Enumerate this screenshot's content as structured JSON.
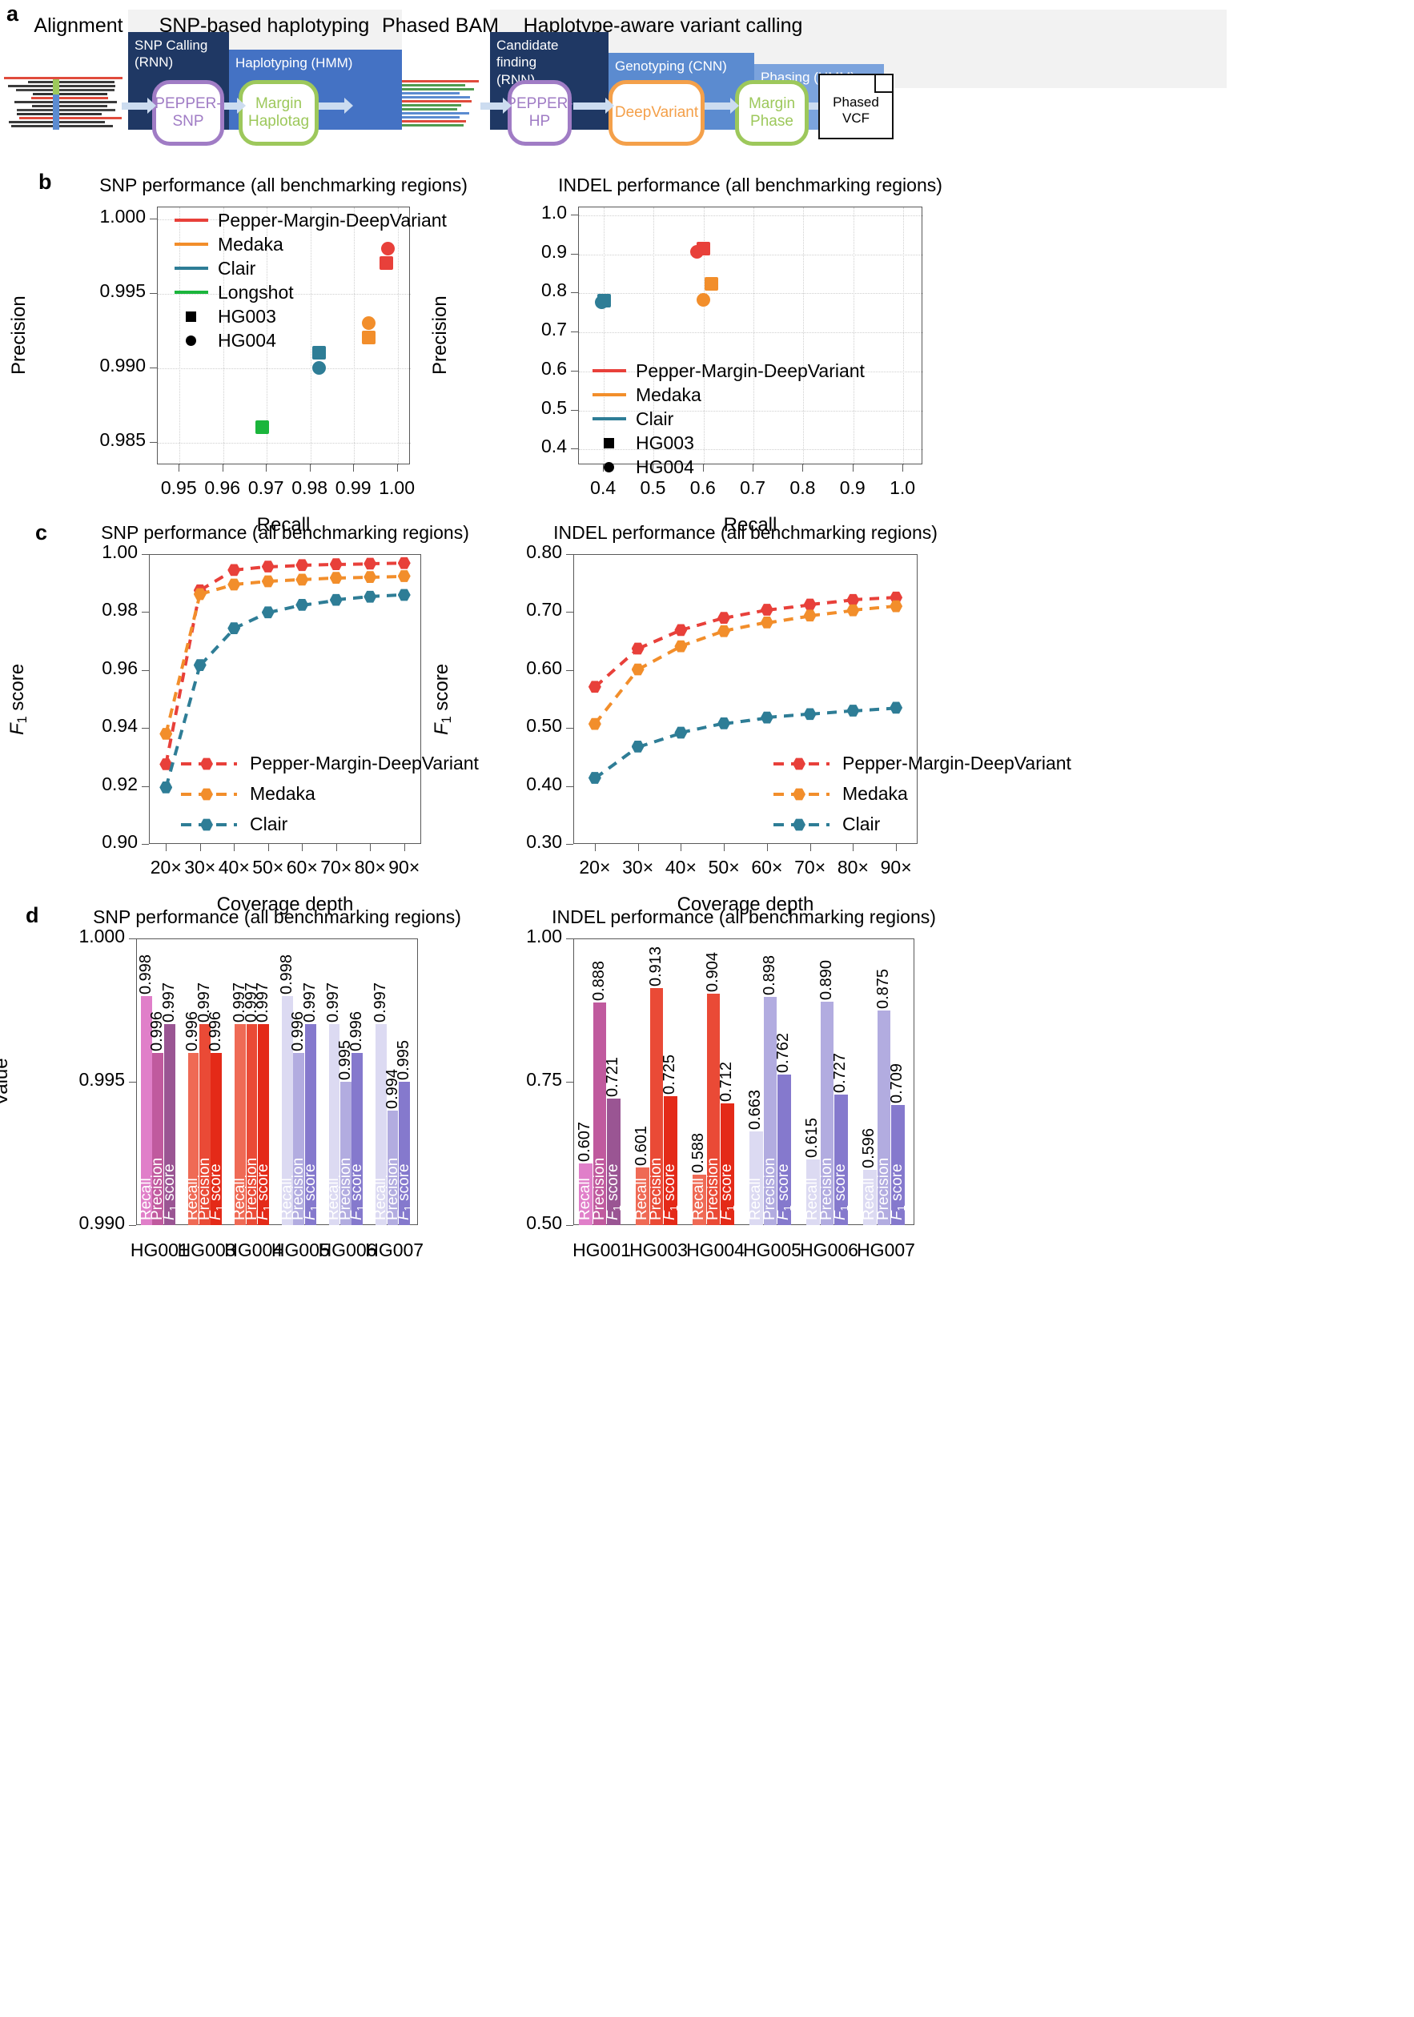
{
  "panels": {
    "a": {
      "letter": "a"
    },
    "b": {
      "letter": "b"
    },
    "c": {
      "letter": "c"
    },
    "d": {
      "letter": "d"
    }
  },
  "diagram": {
    "groups": [
      {
        "label": "Alignment"
      },
      {
        "label": "SNP-based haplotyping"
      },
      {
        "label": "Phased BAM"
      },
      {
        "label": "Haplotype-aware variant calling"
      }
    ],
    "stages": [
      {
        "label": "SNP Calling\n(RNN)",
        "color": "#1f3864"
      },
      {
        "label": "Haplotyping (HMM)",
        "color": "#4472c4"
      },
      {
        "label": "Candidate finding\n(RNN)",
        "color": "#1f3864"
      },
      {
        "label": "Genotyping (CNN)",
        "color": "#5b8bd0"
      },
      {
        "label": "Phasing (HMM)",
        "color": "#7ba3dd"
      }
    ],
    "tools": [
      {
        "label": "PEPPER-\nSNP",
        "color": "#a07cc5"
      },
      {
        "label": "Margin\nHaplotag",
        "color": "#9dc85b"
      },
      {
        "label": "PEPPER-\nHP",
        "color": "#a07cc5"
      },
      {
        "label": "DeepVariant",
        "color": "#f5a košice"
      },
      {
        "label": "Margin\nPhase",
        "color": "#9dc85b"
      }
    ],
    "output": {
      "label": "Phased\nVCF"
    }
  },
  "colors": {
    "pepper": "#e8403a",
    "medaka": "#f28e2b",
    "clair": "#2e7d96",
    "longshot": "#1bb53c",
    "deepvariant_orange": "#f4a04a",
    "purple": "#a07cc5",
    "green": "#9dc85b",
    "navy": "#1f3864",
    "blue": "#4472c4"
  },
  "chart_data": [
    {
      "id": "b-snp",
      "type": "scatter",
      "title": "SNP performance (all benchmarking regions)",
      "xlabel": "Recall",
      "ylabel": "Precision",
      "xlim": [
        0.945,
        1.003
      ],
      "ylim": [
        0.9835,
        1.0008
      ],
      "xticks": [
        "0.95",
        "0.96",
        "0.97",
        "0.98",
        "0.99",
        "1.00"
      ],
      "xtickvals": [
        0.95,
        0.96,
        0.97,
        0.98,
        0.99,
        1.0
      ],
      "yticks": [
        "0.985",
        "0.990",
        "0.995",
        "1.000"
      ],
      "ytickvals": [
        0.985,
        0.99,
        0.995,
        1.0
      ],
      "legend": [
        {
          "label": "Pepper-Margin-DeepVariant",
          "color": "#e8403a",
          "kind": "line"
        },
        {
          "label": "Medaka",
          "color": "#f28e2b",
          "kind": "line"
        },
        {
          "label": "Clair",
          "color": "#2e7d96",
          "kind": "line"
        },
        {
          "label": "Longshot",
          "color": "#1bb53c",
          "kind": "line"
        },
        {
          "label": "HG003",
          "color": "#000000",
          "kind": "square"
        },
        {
          "label": "HG004",
          "color": "#000000",
          "kind": "circle"
        }
      ],
      "points": [
        {
          "series": "Pepper-Margin-DeepVariant",
          "sample": "HG003",
          "marker": "square",
          "color": "#e8403a",
          "x": 0.9975,
          "y": 0.997
        },
        {
          "series": "Pepper-Margin-DeepVariant",
          "sample": "HG004",
          "marker": "circle",
          "color": "#e8403a",
          "x": 0.998,
          "y": 0.998
        },
        {
          "series": "Medaka",
          "sample": "HG003",
          "marker": "square",
          "color": "#f28e2b",
          "x": 0.9935,
          "y": 0.992
        },
        {
          "series": "Medaka",
          "sample": "HG004",
          "marker": "circle",
          "color": "#f28e2b",
          "x": 0.9935,
          "y": 0.993
        },
        {
          "series": "Clair",
          "sample": "HG003",
          "marker": "square",
          "color": "#2e7d96",
          "x": 0.9822,
          "y": 0.991
        },
        {
          "series": "Clair",
          "sample": "HG004",
          "marker": "circle",
          "color": "#2e7d96",
          "x": 0.9822,
          "y": 0.99
        },
        {
          "series": "Longshot",
          "sample": "HG003",
          "marker": "square",
          "color": "#1bb53c",
          "x": 0.9692,
          "y": 0.986
        },
        {
          "series": "Longshot",
          "sample": "HG004",
          "marker": "circle",
          "color": "#1bb53c",
          "x": 0.9692,
          "y": 0.986
        }
      ]
    },
    {
      "id": "b-indel",
      "type": "scatter",
      "title": "INDEL performance (all benchmarking regions)",
      "xlabel": "Recall",
      "ylabel": "Precision",
      "xlim": [
        0.35,
        1.04
      ],
      "ylim": [
        0.36,
        1.02
      ],
      "xticks": [
        "0.4",
        "0.5",
        "0.6",
        "0.7",
        "0.8",
        "0.9",
        "1.0"
      ],
      "xtickvals": [
        0.4,
        0.5,
        0.6,
        0.7,
        0.8,
        0.9,
        1.0
      ],
      "yticks": [
        "0.4",
        "0.5",
        "0.6",
        "0.7",
        "0.8",
        "0.9",
        "1.0"
      ],
      "ytickvals": [
        0.4,
        0.5,
        0.6,
        0.7,
        0.8,
        0.9,
        1.0
      ],
      "legend": [
        {
          "label": "Pepper-Margin-DeepVariant",
          "color": "#e8403a",
          "kind": "line"
        },
        {
          "label": "Medaka",
          "color": "#f28e2b",
          "kind": "line"
        },
        {
          "label": "Clair",
          "color": "#2e7d96",
          "kind": "line"
        },
        {
          "label": "HG003",
          "color": "#000000",
          "kind": "square"
        },
        {
          "label": "HG004",
          "color": "#000000",
          "kind": "circle"
        }
      ],
      "points": [
        {
          "series": "Pepper-Margin-DeepVariant",
          "sample": "HG003",
          "marker": "square",
          "color": "#e8403a",
          "x": 0.601,
          "y": 0.913
        },
        {
          "series": "Pepper-Margin-DeepVariant",
          "sample": "HG004",
          "marker": "circle",
          "color": "#e8403a",
          "x": 0.588,
          "y": 0.904
        },
        {
          "series": "Medaka",
          "sample": "HG003",
          "marker": "square",
          "color": "#f28e2b",
          "x": 0.617,
          "y": 0.823
        },
        {
          "series": "Medaka",
          "sample": "HG004",
          "marker": "circle",
          "color": "#f28e2b",
          "x": 0.601,
          "y": 0.782
        },
        {
          "series": "Clair",
          "sample": "HG003",
          "marker": "square",
          "color": "#2e7d96",
          "x": 0.402,
          "y": 0.78
        },
        {
          "series": "Clair",
          "sample": "HG004",
          "marker": "circle",
          "color": "#2e7d96",
          "x": 0.398,
          "y": 0.776
        }
      ]
    },
    {
      "id": "c-snp",
      "type": "line",
      "title": "SNP performance (all benchmarking regions)",
      "xlabel": "Coverage depth",
      "ylabel": "F1 score",
      "x": [
        "20×",
        "30×",
        "40×",
        "50×",
        "60×",
        "70×",
        "80×",
        "90×"
      ],
      "ylim": [
        0.9,
        1.0
      ],
      "yticks": [
        "0.90",
        "0.92",
        "0.94",
        "0.96",
        "0.98",
        "1.00"
      ],
      "ytickvals": [
        0.9,
        0.92,
        0.94,
        0.96,
        0.98,
        1.0
      ],
      "series": [
        {
          "name": "Pepper-Margin-DeepVariant",
          "color": "#e8403a",
          "values": [
            0.9275,
            0.9875,
            0.9945,
            0.9957,
            0.9962,
            0.9965,
            0.9967,
            0.9969
          ]
        },
        {
          "name": "Medaka",
          "color": "#f28e2b",
          "values": [
            0.938,
            0.9862,
            0.9895,
            0.9906,
            0.9912,
            0.9918,
            0.9921,
            0.9924
          ]
        },
        {
          "name": "Clair",
          "color": "#2e7d96",
          "values": [
            0.9195,
            0.9617,
            0.9744,
            0.9799,
            0.9825,
            0.9842,
            0.9853,
            0.9859
          ]
        }
      ]
    },
    {
      "id": "c-indel",
      "type": "line",
      "title": "INDEL performance (all benchmarking regions)",
      "xlabel": "Coverage depth",
      "ylabel": "F1 score",
      "x": [
        "20×",
        "30×",
        "40×",
        "50×",
        "60×",
        "70×",
        "80×",
        "90×"
      ],
      "ylim": [
        0.3,
        0.8
      ],
      "yticks": [
        "0.30",
        "0.40",
        "0.50",
        "0.60",
        "0.70",
        "0.80"
      ],
      "ytickvals": [
        0.3,
        0.4,
        0.5,
        0.6,
        0.7,
        0.8
      ],
      "series": [
        {
          "name": "Pepper-Margin-DeepVariant",
          "color": "#e8403a",
          "values": [
            0.571,
            0.637,
            0.669,
            0.69,
            0.704,
            0.713,
            0.721,
            0.725
          ]
        },
        {
          "name": "Medaka",
          "color": "#f28e2b",
          "values": [
            0.507,
            0.601,
            0.641,
            0.667,
            0.682,
            0.694,
            0.703,
            0.71
          ]
        },
        {
          "name": "Clair",
          "color": "#2e7d96",
          "values": [
            0.414,
            0.468,
            0.492,
            0.508,
            0.518,
            0.524,
            0.53,
            0.535
          ]
        }
      ]
    },
    {
      "id": "d-snp",
      "type": "bar",
      "title": "SNP performance (all benchmarking regions)",
      "ylabel": "Value",
      "ylim": [
        0.99,
        1.0
      ],
      "yticks": [
        "0.990",
        "0.995",
        "1.000"
      ],
      "ytickvals": [
        0.99,
        0.995,
        1.0
      ],
      "metrics": [
        "Recall",
        "Precision",
        "F1 score"
      ],
      "groups": [
        {
          "label": "HG001",
          "colors": [
            "#e07fc9",
            "#c05a9e",
            "#9a5593"
          ],
          "values": [
            0.998,
            0.996,
            0.997
          ]
        },
        {
          "label": "HG003",
          "colors": [
            "#ef6a55",
            "#ea4a36",
            "#e42a18"
          ],
          "values": [
            0.996,
            0.997,
            0.996
          ]
        },
        {
          "label": "HG004",
          "colors": [
            "#ef6a55",
            "#ea4a36",
            "#e42a18"
          ],
          "values": [
            0.997,
            0.997,
            0.997
          ]
        },
        {
          "label": "HG005",
          "colors": [
            "#dcdaf2",
            "#b2ace0",
            "#8579cd"
          ],
          "values": [
            0.998,
            0.996,
            0.997
          ]
        },
        {
          "label": "HG006",
          "colors": [
            "#dcdaf2",
            "#b2ace0",
            "#8579cd"
          ],
          "values": [
            0.997,
            0.995,
            0.996
          ]
        },
        {
          "label": "HG007",
          "colors": [
            "#dcdaf2",
            "#b2ace0",
            "#8579cd"
          ],
          "values": [
            0.997,
            0.994,
            0.995
          ]
        }
      ]
    },
    {
      "id": "d-indel",
      "type": "bar",
      "title": "INDEL performance (all benchmarking regions)",
      "ylabel": "",
      "ylim": [
        0.5,
        1.0
      ],
      "yticks": [
        "0.50",
        "0.75",
        "1.00"
      ],
      "ytickvals": [
        0.5,
        0.75,
        1.0
      ],
      "metrics": [
        "Recall",
        "Precision",
        "F1 score"
      ],
      "groups": [
        {
          "label": "HG001",
          "colors": [
            "#e07fc9",
            "#c05a9e",
            "#9a5593"
          ],
          "values": [
            0.607,
            0.888,
            0.721
          ]
        },
        {
          "label": "HG003",
          "colors": [
            "#ef6a55",
            "#ea4a36",
            "#e42a18"
          ],
          "values": [
            0.601,
            0.913,
            0.725
          ]
        },
        {
          "label": "HG004",
          "colors": [
            "#ef6a55",
            "#ea4a36",
            "#e42a18"
          ],
          "values": [
            0.588,
            0.904,
            0.712
          ]
        },
        {
          "label": "HG005",
          "colors": [
            "#dcdaf2",
            "#b2ace0",
            "#8579cd"
          ],
          "values": [
            0.663,
            0.898,
            0.762
          ]
        },
        {
          "label": "HG006",
          "colors": [
            "#dcdaf2",
            "#b2ace0",
            "#8579cd"
          ],
          "values": [
            0.615,
            0.89,
            0.727
          ]
        },
        {
          "label": "HG007",
          "colors": [
            "#dcdaf2",
            "#b2ace0",
            "#8579cd"
          ],
          "values": [
            0.596,
            0.875,
            0.709
          ]
        }
      ]
    }
  ]
}
